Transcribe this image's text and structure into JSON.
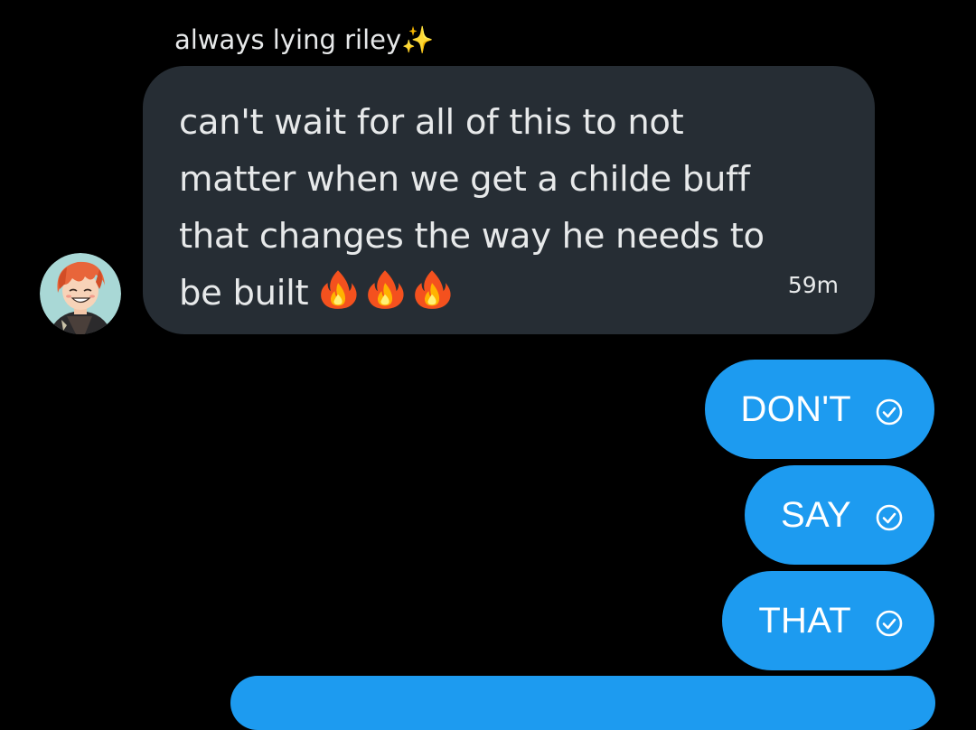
{
  "conversation": {
    "incoming": {
      "sender_name": "always lying riley✨",
      "text_lines": [
        "can't wait for all of this to not",
        "matter when we get a childe buff",
        "that changes the way he needs to",
        "be built"
      ],
      "emoji": "🔥🔥🔥",
      "timestamp": "59m",
      "bubble_color": "#262d34"
    },
    "outgoing": [
      {
        "text": "DON'T",
        "status_icon": "sent-check-icon"
      },
      {
        "text": "SAY",
        "status_icon": "sent-check-icon"
      },
      {
        "text": "THAT",
        "status_icon": "sent-check-icon"
      }
    ],
    "outgoing_color": "#1d9bf0",
    "background_color": "#000000"
  }
}
